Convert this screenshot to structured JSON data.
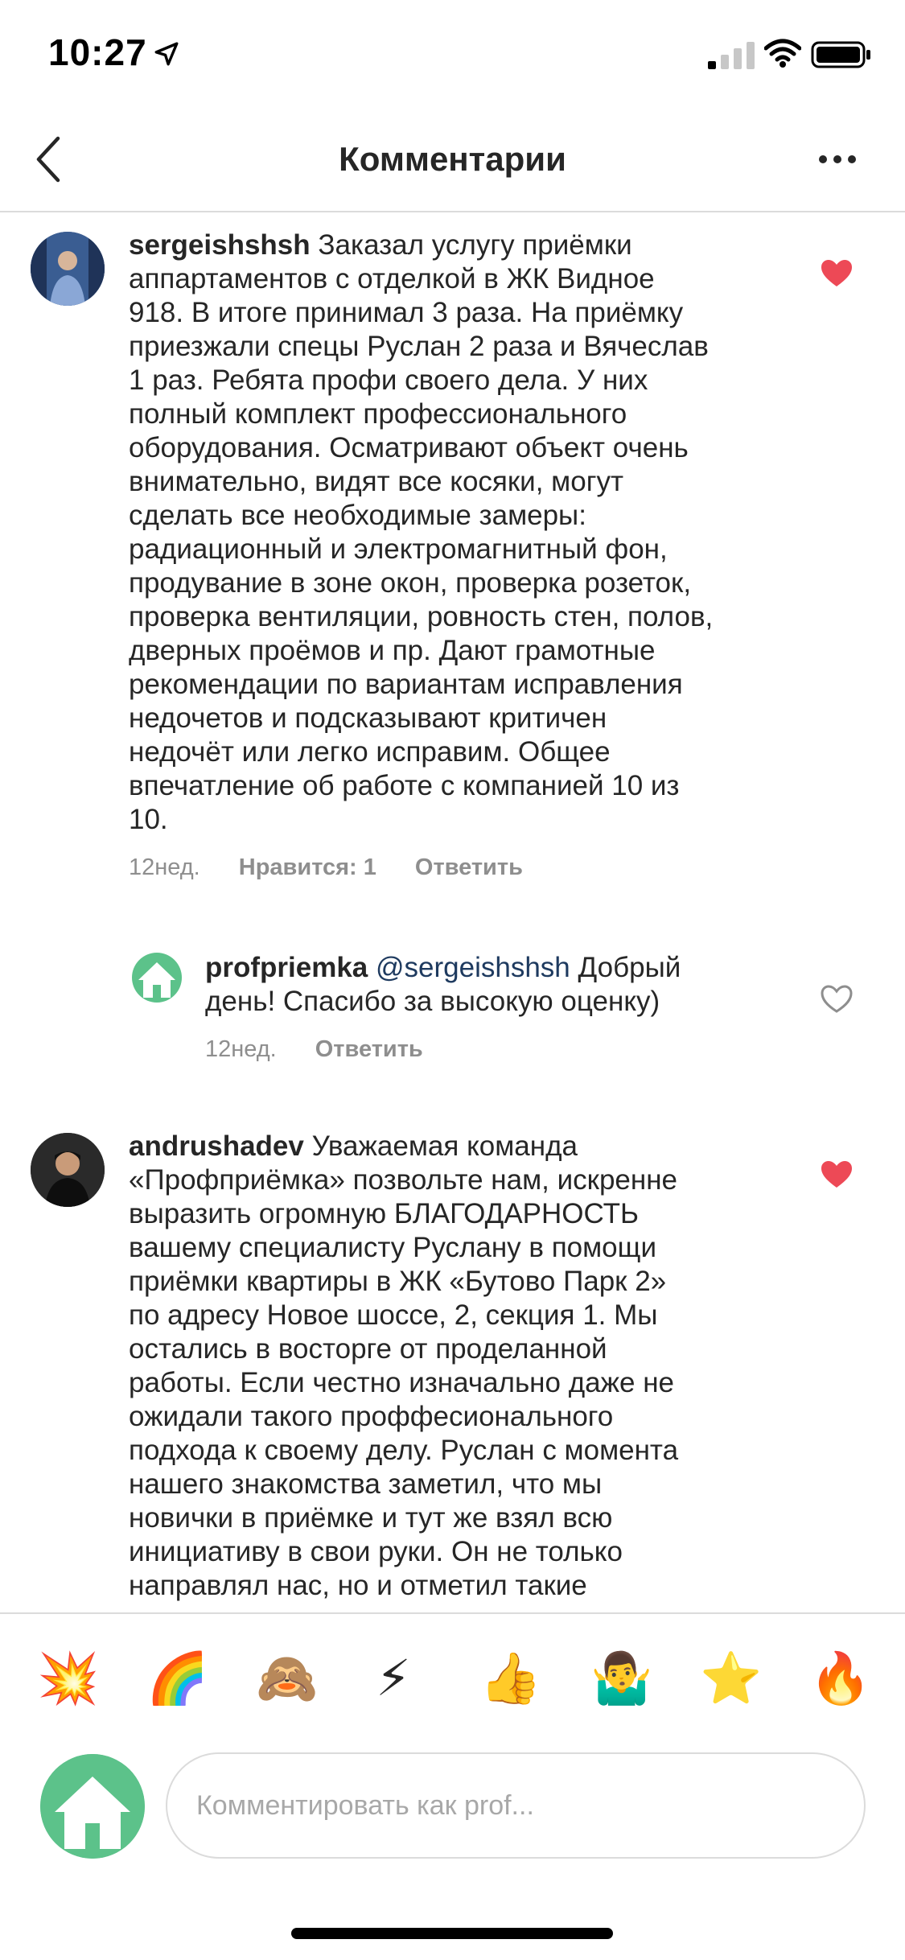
{
  "status_bar": {
    "time": "10:27"
  },
  "nav": {
    "title": "Комментарии"
  },
  "comments": [
    {
      "username": "sergeishshsh",
      "lines": [
        " Заказал услугу приёмки",
        "аппартаментов с отделкой в ЖК Видное",
        "918. В итоге принимал 3 раза. На приёмку",
        "приезжали спецы Руслан 2 раза и Вячеслав",
        "1 раз. Ребята профи своего дела. У них",
        "полный комплект профессионального",
        "оборудования. Осматривают объект очень",
        "внимательно, видят все косяки, могут",
        "сделать все необходимые замеры:",
        "радиационный и электромагнитный фон,",
        "продувание в зоне окон, проверка розеток,",
        "проверка вентиляции, ровность стен, полов,",
        "дверных проёмов и пр. Дают грамотные",
        "рекомендации по вариантам исправления",
        "недочетов и подсказывают критичен",
        "недочёт или легко исправим. Общее",
        "впечатление об работе с компанией 10 из",
        "10."
      ],
      "time": "12нед.",
      "likes": "Нравится: 1",
      "reply": "Ответить",
      "liked": true
    },
    {
      "username": "profpriemka",
      "mention": "@sergeishshsh",
      "lines": [
        " Добрый",
        "день! Спасибо за высокую оценку)"
      ],
      "time": "12нед.",
      "reply": "Ответить",
      "liked": false
    },
    {
      "username": "andrushadev",
      "lines": [
        " Уважаемая команда",
        "«Профприёмка» позвольте нам, искренне",
        "выразить огромную  БЛАГОДАРНОСТЬ",
        "вашему специалисту Руслану в помощи",
        "приёмки квартиры в  ЖК «Бутово Парк 2»",
        "по адресу Новое шоссе, 2, секция 1. Мы",
        "остались в восторге от проделанной",
        "работы. Если честно изначально даже не",
        "ожидали такого проффесионального",
        "подхода к своему делу. Руслан с момента",
        "нашего знакомства заметил, что мы",
        "новички в приёмке и тут же взял всю",
        "инициативу в свои руки. Он не только",
        "направлял нас, но и отметил такие"
      ],
      "liked": true
    }
  ],
  "emoji_bar": [
    "💥",
    "🌈",
    "🙈",
    "⚡",
    "👍",
    "🤷‍♂️",
    "⭐",
    "🔥"
  ],
  "input": {
    "placeholder": "Комментировать как prof..."
  },
  "colors": {
    "heart_liked": "#ed4956",
    "mention": "#1e3a5f",
    "meta": "#8e8e8e",
    "brand_green": "#5cc28a"
  }
}
